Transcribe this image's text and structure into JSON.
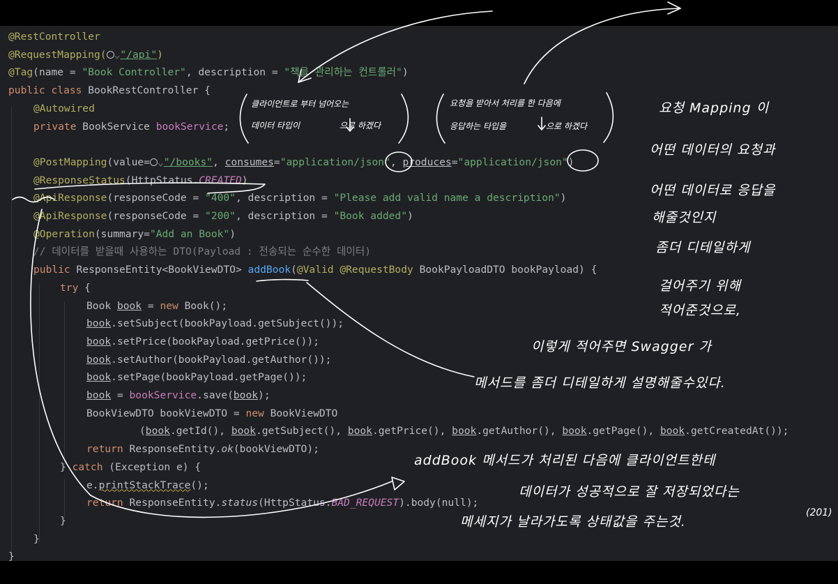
{
  "code": {
    "annotations": {
      "rest_controller": "@RestController",
      "request_mapping": "@RequestMapping(",
      "request_mapping_path": "\"/api\"",
      "request_mapping_close": ")",
      "tag": "@Tag",
      "tag_args": "(name = ",
      "tag_name": "\"Book Controller\"",
      "tag_desc_key": ", description = ",
      "tag_desc": "\"책을 관리하는 컨트롤러\"",
      "tag_close": ")"
    },
    "class_decl": {
      "keywords": "public class",
      "name": " BookRestController {"
    },
    "autowired": "@Autowired",
    "field": {
      "keyword": "private",
      "type": " BookService ",
      "name": "bookService",
      "end": ";"
    },
    "post_mapping": {
      "annotation": "@PostMapping",
      "value_open": "(value=",
      "path": "\"/books\"",
      "consumes_label": "consumes",
      "consumes": "\"application/json\"",
      "produces_label": "produces",
      "produces": "\"application/json\"",
      "close": ")"
    },
    "response_status": {
      "annotation": "@ResponseStatus",
      "open": "(HttpStatus.",
      "constant": "CREATED",
      "close": ")"
    },
    "api_response_1": {
      "annotation": "@ApiResponse",
      "args": "(responseCode = ",
      "code": "\"400\"",
      "desc_key": ", description = ",
      "desc": "\"Please add valid name a description\"",
      "close": ")"
    },
    "api_response_2": {
      "annotation": "@ApiResponse",
      "args": "(responseCode = ",
      "code": "\"200\"",
      "desc_key": ", description = ",
      "desc": "\"Book added\"",
      "close": ")"
    },
    "operation": {
      "annotation": "@Operation",
      "open": "(summary=",
      "summary": "\"Add an Book\"",
      "close": ")"
    },
    "comment": "// 데이터를 받을때 사용하는 DTO(Payload : 전송되는 순수한 데이터)",
    "method_decl": {
      "keyword": "public",
      "return_type": " ResponseEntity<BookViewDTO> ",
      "name": "addBook",
      "open": "(",
      "valid": "@Valid",
      "request_body": "@RequestBody",
      "params": " BookPayloadDTO bookPayload) {"
    },
    "try_keyword": "try",
    "try_brace": " {",
    "body": {
      "line1_type": "Book ",
      "var": "book",
      "line1_eq": " = ",
      "new_kw": "new",
      "line1_rest": " Book();",
      "set_subject": ".setSubject(bookPayload.getSubject());",
      "set_price": ".setPrice(bookPayload.getPrice());",
      "set_author": ".setAuthor(bookPayload.getAuthor());",
      "set_page": ".setPage(bookPayload.getPage());",
      "save_mid": " = ",
      "service_field": "bookService",
      "save_call": ".save(",
      "save_end": ");",
      "view_decl": "BookViewDTO bookViewDTO = ",
      "view_rest": " BookViewDTO",
      "args_open": "(",
      "get_id": ".getId(), ",
      "get_subject": ".getSubject(), ",
      "get_price": ".getPrice(), ",
      "get_author": ".getAuthor(), ",
      "get_page": ".getPage(), ",
      "get_created": ".getCreatedAt());",
      "return_kw": "return",
      "return_ok_pre": " ResponseEntity.",
      "return_ok_method": "ok",
      "return_ok_args": "(bookViewDTO);"
    },
    "catch_close": "} ",
    "catch_kw": "catch",
    "catch_rest": " (Exception e) {",
    "print_pre": "e.",
    "print_method": "printStackTrace",
    "print_end": "();",
    "return_bad_pre": " ResponseEntity.",
    "return_bad_method": "status",
    "return_bad_open": "(HttpStatus.",
    "return_bad_constant": "BAD_REQUEST",
    "return_bad_end": ").body(null);",
    "brace_close": "}"
  },
  "handwritten_notes": {
    "consumes_note": [
      "클라이언트로 부터 넘어오는",
      "데이터 타입이",
      "으로 하겠다"
    ],
    "produces_note": [
      "요청을 받아서 처리를 한 다음에",
      "응답하는 타입을",
      "으로 하겠다"
    ],
    "right_note": [
      "요청 Mapping 이",
      "어떤 데이터의 요청과",
      "어떤 데이터로 응답을",
      "해줄것인지",
      "좀더 디테일하게",
      "걸어주기 위해",
      "적어준것으로,"
    ],
    "middle_note": [
      "이렇게 적어주면 Swagger 가",
      "메서드를 좀더 디테일하게 설명해줄수있다."
    ],
    "bottom_note": [
      "addBook 메서드가 처리된 다음에 클라이언트한테",
      "데이터가 성공적으로 잘 저장되었다는",
      "메세지가 날라가도록 상태값을 주는것.",
      "(201)"
    ]
  },
  "colors": {
    "editor_bg": "#1f2024",
    "text": "#bcbec4",
    "annotation": "#b3ae60",
    "keyword": "#cf8e6d",
    "string": "#6aab73",
    "field": "#c77dbb",
    "method": "#56a8f5",
    "comment": "#7a7e85",
    "ink": "#ffffff"
  }
}
